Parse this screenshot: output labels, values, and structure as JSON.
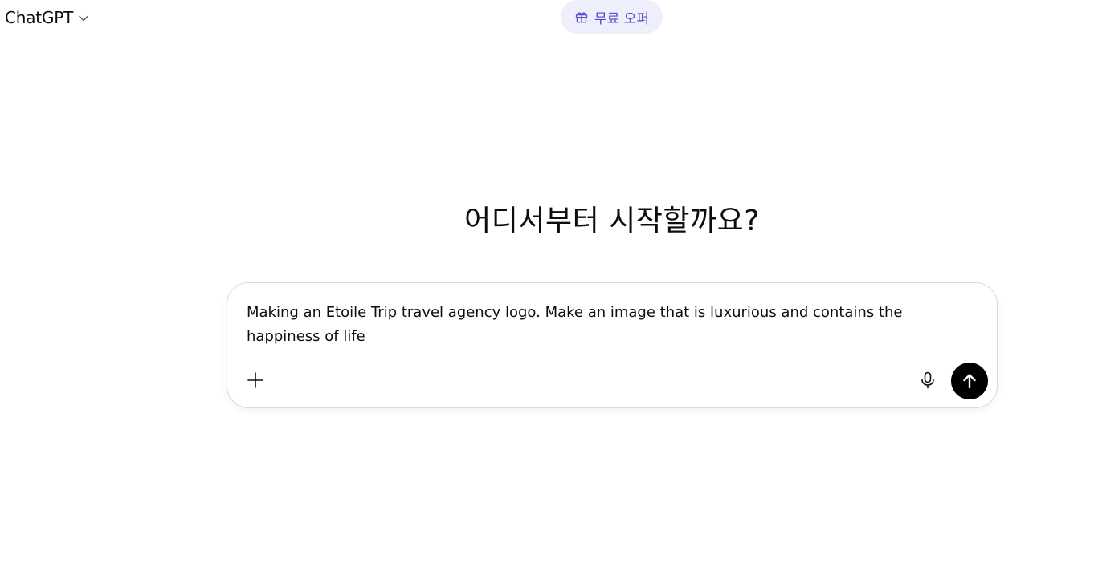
{
  "header": {
    "model_name": "ChatGPT",
    "offer_label": "무료 오퍼"
  },
  "main": {
    "title": "어디서부터 시작할까요?"
  },
  "composer": {
    "value": "Making an Etoile Trip travel agency logo. Make an image that is luxurious and contains the happiness of life"
  },
  "icons": {
    "chevron": "chevron-down-icon",
    "gift": "gift-icon",
    "plus": "plus-icon",
    "mic": "microphone-icon",
    "send": "arrow-up-icon"
  },
  "colors": {
    "offer_bg": "#eeeefc",
    "offer_text": "#5150c9",
    "send_bg": "#000000"
  }
}
